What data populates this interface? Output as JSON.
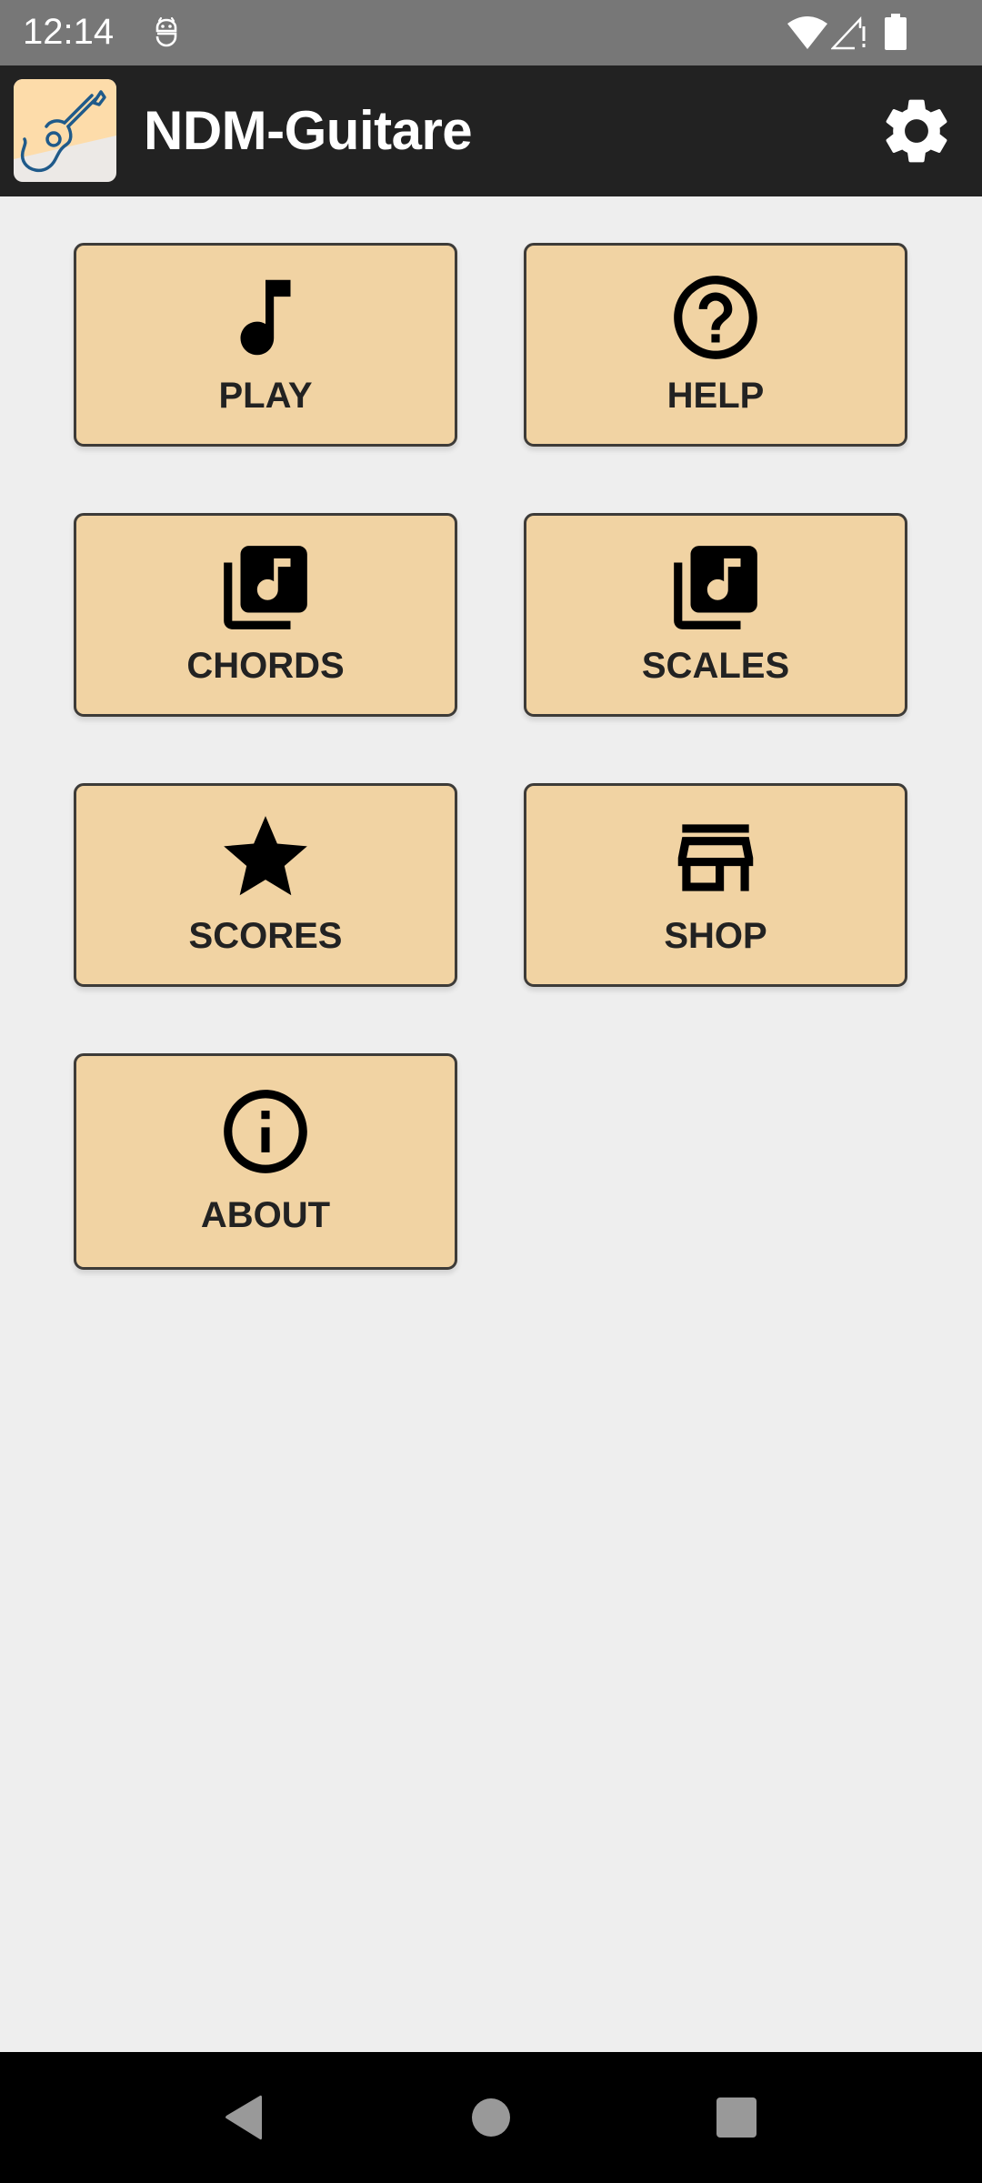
{
  "status_bar": {
    "time": "12:14",
    "icons": [
      "notification-robot-icon",
      "wifi-icon",
      "signal-no-data-icon",
      "battery-full-icon"
    ]
  },
  "app_bar": {
    "title": "NDM-Guitare",
    "app_icon": "guitar-icon",
    "settings_icon": "gear-icon"
  },
  "menu": {
    "items": [
      {
        "id": "play",
        "label": "PLAY",
        "icon": "music-note-icon"
      },
      {
        "id": "help",
        "label": "HELP",
        "icon": "help-circle-icon"
      },
      {
        "id": "chords",
        "label": "CHORDS",
        "icon": "library-music-icon"
      },
      {
        "id": "scales",
        "label": "SCALES",
        "icon": "library-music-icon"
      },
      {
        "id": "scores",
        "label": "SCORES",
        "icon": "star-icon"
      },
      {
        "id": "shop",
        "label": "SHOP",
        "icon": "storefront-icon"
      },
      {
        "id": "about",
        "label": "ABOUT",
        "icon": "info-circle-icon"
      }
    ]
  },
  "nav_bar": {
    "back": "back-icon",
    "home": "home-icon",
    "recents": "recents-icon"
  },
  "colors": {
    "status_bar": "#777777",
    "app_bar": "#222222",
    "background": "#eeeeee",
    "card_fill": "#f1d3a3",
    "card_border": "#3d3b38",
    "nav_bar": "#000000",
    "nav_icons": "#999999",
    "app_icon_blue": "#1f5a8a"
  }
}
